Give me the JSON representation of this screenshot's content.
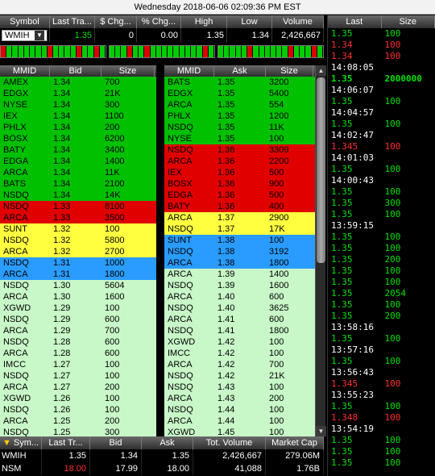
{
  "title": "Wednesday 2018-06-06 02:09:36 PM EST",
  "quote": {
    "headers": [
      "Symbol",
      "Last Tra...",
      "$ Chg...",
      "% Chg...",
      "High",
      "Low",
      "Volume"
    ],
    "symbol": "WMIH",
    "last": "1.35",
    "chg": "0",
    "pct_chg": "0.00",
    "high": "1.35",
    "low": "1.34",
    "volume": "2,426,667"
  },
  "level_bars": [
    [
      "#d00",
      "#0c0",
      "#0c0",
      "#0c0",
      "#0c0",
      "#0c0",
      "#0c0",
      "#0c0",
      "#d00",
      "#0c0",
      "#0c0",
      "#0c0",
      "#0c0",
      "#d00",
      "#0c0",
      "#0c0",
      "#d00",
      "#0c0"
    ],
    [
      "#0c0",
      "#0c0",
      "#0c0",
      "#d00",
      "#0c0",
      "#0c0",
      "#d00",
      "#0c0",
      "#0c0",
      "#0c0",
      "#0c0",
      "#0c0",
      "#0c0",
      "#0c0",
      "#0c0",
      "#0c0",
      "#d00",
      "#0c0"
    ],
    [
      "#0c0",
      "#0c0",
      "#0c0",
      "#0c0",
      "#0c0",
      "#d00",
      "#0c0",
      "#0c0",
      "#0c0",
      "#0c0",
      "#0c0",
      "#0c0",
      "#d00",
      "#0c0",
      "#0c0",
      "#0c0",
      "#d00",
      "#0c0"
    ]
  ],
  "bid_book": {
    "headers": [
      "MMID",
      "Bid",
      "Size"
    ],
    "rows": [
      {
        "mmid": "AMEX",
        "price": "1.34",
        "size": "700",
        "bg": "#00c000",
        "fg": "#000"
      },
      {
        "mmid": "EDGX",
        "price": "1.34",
        "size": "21K",
        "bg": "#00c000",
        "fg": "#000"
      },
      {
        "mmid": "NYSE",
        "price": "1.34",
        "size": "300",
        "bg": "#00c000",
        "fg": "#000"
      },
      {
        "mmid": "IEX",
        "price": "1.34",
        "size": "1100",
        "bg": "#00c000",
        "fg": "#000"
      },
      {
        "mmid": "PHLX",
        "price": "1.34",
        "size": "200",
        "bg": "#00c000",
        "fg": "#000"
      },
      {
        "mmid": "BOSX",
        "price": "1.34",
        "size": "6200",
        "bg": "#00c000",
        "fg": "#000"
      },
      {
        "mmid": "BATY",
        "price": "1.34",
        "size": "3400",
        "bg": "#00c000",
        "fg": "#000"
      },
      {
        "mmid": "EDGA",
        "price": "1.34",
        "size": "1400",
        "bg": "#00c000",
        "fg": "#000"
      },
      {
        "mmid": "ARCA",
        "price": "1.34",
        "size": "11K",
        "bg": "#00c000",
        "fg": "#000"
      },
      {
        "mmid": "BATS",
        "price": "1.34",
        "size": "2100",
        "bg": "#00c000",
        "fg": "#000"
      },
      {
        "mmid": "NSDQ",
        "price": "1.34",
        "size": "14K",
        "bg": "#00c000",
        "fg": "#000"
      },
      {
        "mmid": "NSDQ",
        "price": "1.33",
        "size": "8100",
        "bg": "#e00000",
        "fg": "#000"
      },
      {
        "mmid": "ARCA",
        "price": "1.33",
        "size": "3500",
        "bg": "#e00000",
        "fg": "#000"
      },
      {
        "mmid": "SUNT",
        "price": "1.32",
        "size": "100",
        "bg": "#ffff40",
        "fg": "#000"
      },
      {
        "mmid": "NSDQ",
        "price": "1.32",
        "size": "5800",
        "bg": "#ffff40",
        "fg": "#000"
      },
      {
        "mmid": "ARCA",
        "price": "1.32",
        "size": "2700",
        "bg": "#ffff40",
        "fg": "#000"
      },
      {
        "mmid": "NSDQ",
        "price": "1.31",
        "size": "1000",
        "bg": "#2a9cff",
        "fg": "#000"
      },
      {
        "mmid": "ARCA",
        "price": "1.31",
        "size": "1800",
        "bg": "#2a9cff",
        "fg": "#000"
      },
      {
        "mmid": "NSDQ",
        "price": "1.30",
        "size": "5604",
        "bg": "#c8f7c8",
        "fg": "#000"
      },
      {
        "mmid": "ARCA",
        "price": "1.30",
        "size": "1600",
        "bg": "#c8f7c8",
        "fg": "#000"
      },
      {
        "mmid": "XGWD",
        "price": "1.29",
        "size": "100",
        "bg": "#c8f7c8",
        "fg": "#000"
      },
      {
        "mmid": "NSDQ",
        "price": "1.29",
        "size": "600",
        "bg": "#c8f7c8",
        "fg": "#000"
      },
      {
        "mmid": "ARCA",
        "price": "1.29",
        "size": "700",
        "bg": "#c8f7c8",
        "fg": "#000"
      },
      {
        "mmid": "NSDQ",
        "price": "1.28",
        "size": "600",
        "bg": "#c8f7c8",
        "fg": "#000"
      },
      {
        "mmid": "ARCA",
        "price": "1.28",
        "size": "600",
        "bg": "#c8f7c8",
        "fg": "#000"
      },
      {
        "mmid": "IMCC",
        "price": "1.27",
        "size": "100",
        "bg": "#c8f7c8",
        "fg": "#000"
      },
      {
        "mmid": "NSDQ",
        "price": "1.27",
        "size": "100",
        "bg": "#c8f7c8",
        "fg": "#000"
      },
      {
        "mmid": "ARCA",
        "price": "1.27",
        "size": "200",
        "bg": "#c8f7c8",
        "fg": "#000"
      },
      {
        "mmid": "XGWD",
        "price": "1.26",
        "size": "100",
        "bg": "#c8f7c8",
        "fg": "#000"
      },
      {
        "mmid": "NSDQ",
        "price": "1.26",
        "size": "100",
        "bg": "#c8f7c8",
        "fg": "#000"
      },
      {
        "mmid": "ARCA",
        "price": "1.25",
        "size": "200",
        "bg": "#c8f7c8",
        "fg": "#000"
      },
      {
        "mmid": "NSDQ",
        "price": "1.25",
        "size": "300",
        "bg": "#c8f7c8",
        "fg": "#000"
      }
    ]
  },
  "ask_book": {
    "headers": [
      "MMID",
      "Ask",
      "Size"
    ],
    "rows": [
      {
        "mmid": "BATS",
        "price": "1.35",
        "size": "3200",
        "bg": "#00c000",
        "fg": "#000"
      },
      {
        "mmid": "EDGX",
        "price": "1.35",
        "size": "5400",
        "bg": "#00c000",
        "fg": "#000"
      },
      {
        "mmid": "ARCA",
        "price": "1.35",
        "size": "554",
        "bg": "#00c000",
        "fg": "#000"
      },
      {
        "mmid": "PHLX",
        "price": "1.35",
        "size": "1200",
        "bg": "#00c000",
        "fg": "#000"
      },
      {
        "mmid": "NSDQ",
        "price": "1.35",
        "size": "11K",
        "bg": "#00c000",
        "fg": "#000"
      },
      {
        "mmid": "NYSE",
        "price": "1.35",
        "size": "100",
        "bg": "#00c000",
        "fg": "#000"
      },
      {
        "mmid": "NSDQ",
        "price": "1.36",
        "size": "3309",
        "bg": "#e00000",
        "fg": "#000"
      },
      {
        "mmid": "ARCA",
        "price": "1.36",
        "size": "2200",
        "bg": "#e00000",
        "fg": "#000"
      },
      {
        "mmid": "IEX",
        "price": "1.36",
        "size": "500",
        "bg": "#e00000",
        "fg": "#000"
      },
      {
        "mmid": "BOSX",
        "price": "1.36",
        "size": "900",
        "bg": "#e00000",
        "fg": "#000"
      },
      {
        "mmid": "EDGA",
        "price": "1.36",
        "size": "500",
        "bg": "#e00000",
        "fg": "#000"
      },
      {
        "mmid": "BATY",
        "price": "1.36",
        "size": "400",
        "bg": "#e00000",
        "fg": "#000"
      },
      {
        "mmid": "ARCA",
        "price": "1.37",
        "size": "2900",
        "bg": "#ffff40",
        "fg": "#000"
      },
      {
        "mmid": "NSDQ",
        "price": "1.37",
        "size": "17K",
        "bg": "#ffff40",
        "fg": "#000"
      },
      {
        "mmid": "SUNT",
        "price": "1.38",
        "size": "100",
        "bg": "#2a9cff",
        "fg": "#000"
      },
      {
        "mmid": "NSDQ",
        "price": "1.38",
        "size": "3192",
        "bg": "#2a9cff",
        "fg": "#000"
      },
      {
        "mmid": "ARCA",
        "price": "1.38",
        "size": "1800",
        "bg": "#2a9cff",
        "fg": "#000"
      },
      {
        "mmid": "ARCA",
        "price": "1.39",
        "size": "1400",
        "bg": "#c8f7c8",
        "fg": "#000"
      },
      {
        "mmid": "NSDQ",
        "price": "1.39",
        "size": "1600",
        "bg": "#c8f7c8",
        "fg": "#000"
      },
      {
        "mmid": "ARCA",
        "price": "1.40",
        "size": "600",
        "bg": "#c8f7c8",
        "fg": "#000"
      },
      {
        "mmid": "NSDQ",
        "price": "1.40",
        "size": "3625",
        "bg": "#c8f7c8",
        "fg": "#000"
      },
      {
        "mmid": "ARCA",
        "price": "1.41",
        "size": "600",
        "bg": "#c8f7c8",
        "fg": "#000"
      },
      {
        "mmid": "NSDQ",
        "price": "1.41",
        "size": "1800",
        "bg": "#c8f7c8",
        "fg": "#000"
      },
      {
        "mmid": "XGWD",
        "price": "1.42",
        "size": "100",
        "bg": "#c8f7c8",
        "fg": "#000"
      },
      {
        "mmid": "IMCC",
        "price": "1.42",
        "size": "100",
        "bg": "#c8f7c8",
        "fg": "#000"
      },
      {
        "mmid": "ARCA",
        "price": "1.42",
        "size": "700",
        "bg": "#c8f7c8",
        "fg": "#000"
      },
      {
        "mmid": "NSDQ",
        "price": "1.42",
        "size": "21K",
        "bg": "#c8f7c8",
        "fg": "#000"
      },
      {
        "mmid": "NSDQ",
        "price": "1.43",
        "size": "100",
        "bg": "#c8f7c8",
        "fg": "#000"
      },
      {
        "mmid": "ARCA",
        "price": "1.43",
        "size": "200",
        "bg": "#c8f7c8",
        "fg": "#000"
      },
      {
        "mmid": "NSDQ",
        "price": "1.44",
        "size": "100",
        "bg": "#c8f7c8",
        "fg": "#000"
      },
      {
        "mmid": "ARCA",
        "price": "1.44",
        "size": "100",
        "bg": "#c8f7c8",
        "fg": "#000"
      },
      {
        "mmid": "XGWD",
        "price": "1.45",
        "size": "100",
        "bg": "#c8f7c8",
        "fg": "#000"
      }
    ]
  },
  "watchlist": {
    "headers": [
      "Sym...",
      "Last Tr...",
      "Bid",
      "Ask",
      "Tot. Volume",
      "Market Cap"
    ],
    "rows": [
      {
        "sym": "WMIH",
        "last": "1.35",
        "last_color": "#ffffff",
        "bid": "1.34",
        "ask": "1.35",
        "vol": "2,426,667",
        "cap": "279.06M"
      },
      {
        "sym": "NSM",
        "last": "18.00",
        "last_color": "#ff3030",
        "bid": "17.99",
        "ask": "18.00",
        "vol": "41,088",
        "cap": "1.76B"
      }
    ]
  },
  "time_sales": {
    "headers": [
      "Last",
      "Size"
    ],
    "rows": [
      {
        "price": "1.35",
        "size": "100",
        "color": "#00e000"
      },
      {
        "price": "1.34",
        "size": "100",
        "color": "#ff3030"
      },
      {
        "price": "1.34",
        "size": "100",
        "color": "#ff3030"
      },
      {
        "time": "14:08:05"
      },
      {
        "price": "1.35",
        "size": "2000000",
        "color": "#00e000",
        "bold": true
      },
      {
        "time": "14:06:07"
      },
      {
        "price": "1.35",
        "size": "100",
        "color": "#00e000"
      },
      {
        "time": "14:04:57"
      },
      {
        "price": "1.35",
        "size": "100",
        "color": "#00e000"
      },
      {
        "time": "14:02:47"
      },
      {
        "price": "1.345",
        "size": "100",
        "color": "#ff3030"
      },
      {
        "time": "14:01:03"
      },
      {
        "price": "1.35",
        "size": "100",
        "color": "#00e000"
      },
      {
        "time": "14:00:43"
      },
      {
        "price": "1.35",
        "size": "100",
        "color": "#00e000"
      },
      {
        "price": "1.35",
        "size": "300",
        "color": "#00e000"
      },
      {
        "price": "1.35",
        "size": "100",
        "color": "#00e000"
      },
      {
        "time": "13:59:15"
      },
      {
        "price": "1.35",
        "size": "100",
        "color": "#00e000"
      },
      {
        "price": "1.35",
        "size": "100",
        "color": "#00e000"
      },
      {
        "price": "1.35",
        "size": "200",
        "color": "#00e000"
      },
      {
        "price": "1.35",
        "size": "100",
        "color": "#00e000"
      },
      {
        "price": "1.35",
        "size": "100",
        "color": "#00e000"
      },
      {
        "price": "1.35",
        "size": "2054",
        "color": "#00e000"
      },
      {
        "price": "1.35",
        "size": "100",
        "color": "#00e000"
      },
      {
        "price": "1.35",
        "size": "200",
        "color": "#00e000"
      },
      {
        "time": "13:58:16"
      },
      {
        "price": "1.35",
        "size": "100",
        "color": "#00e000"
      },
      {
        "time": "13:57:16"
      },
      {
        "price": "1.35",
        "size": "100",
        "color": "#00e000"
      },
      {
        "time": "13:56:43"
      },
      {
        "price": "1.345",
        "size": "100",
        "color": "#ff3030"
      },
      {
        "time": "13:55:23"
      },
      {
        "price": "1.35",
        "size": "100",
        "color": "#00e000"
      },
      {
        "price": "1.348",
        "size": "100",
        "color": "#ff3030"
      },
      {
        "time": "13:54:19"
      },
      {
        "price": "1.35",
        "size": "100",
        "color": "#00e000"
      },
      {
        "price": "1.35",
        "size": "100",
        "color": "#00e000"
      },
      {
        "price": "1.35",
        "size": "100",
        "color": "#00e000"
      }
    ]
  }
}
